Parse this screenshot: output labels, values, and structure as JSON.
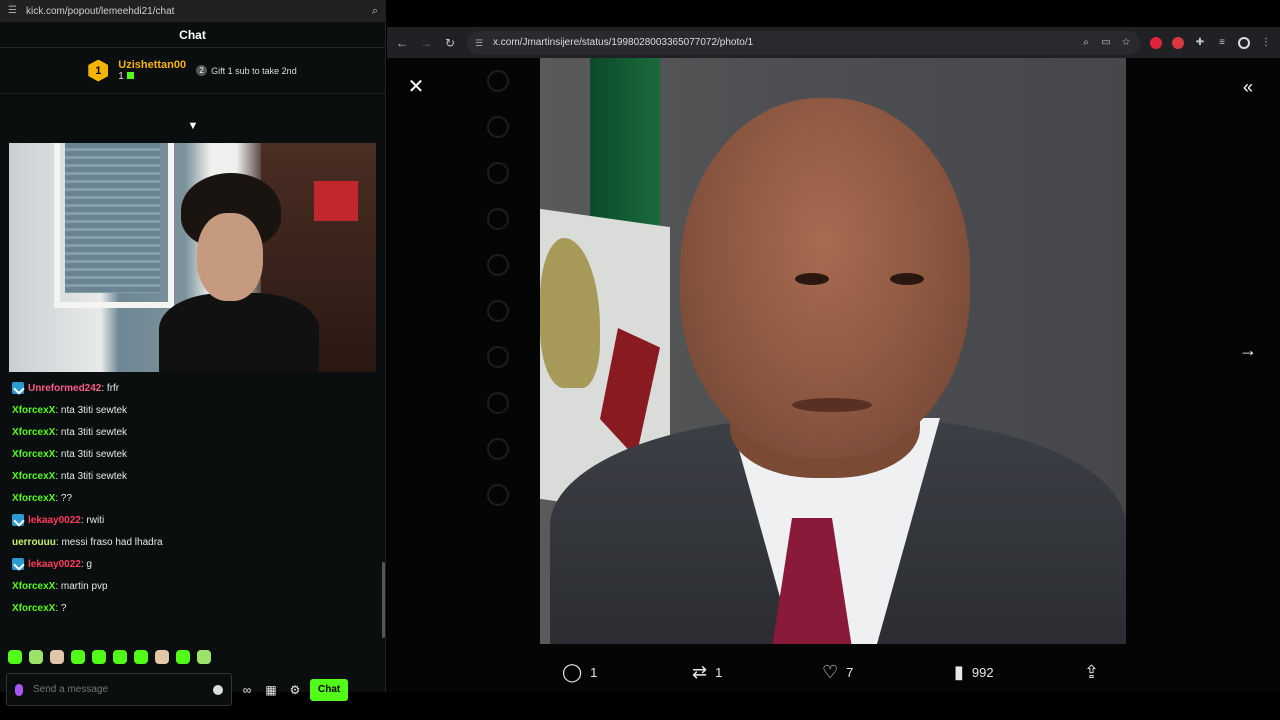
{
  "kick": {
    "url": "kick.com/popout/lemeehdi21/chat",
    "header_title": "Chat",
    "top_gifter": {
      "rank": "1",
      "name": "Uzishettan00",
      "count": "1"
    },
    "gift_cta": {
      "rank": "2",
      "label": "Gift 1 sub to take 2nd"
    },
    "messages": [
      {
        "user": "Unreformed242",
        "text": ": frfr",
        "color": "#ff5c8a",
        "badge": true
      },
      {
        "user": "XforcexX",
        "text": ": nta 3titi sewtek",
        "color": "#53fc18",
        "badge": false
      },
      {
        "user": "XforcexX",
        "text": ": nta 3titi sewtek",
        "color": "#53fc18",
        "badge": false
      },
      {
        "user": "XforcexX",
        "text": ": nta 3titi sewtek",
        "color": "#53fc18",
        "badge": false
      },
      {
        "user": "XforcexX",
        "text": ": nta 3titi sewtek",
        "color": "#53fc18",
        "badge": false
      },
      {
        "user": "XforcexX",
        "text": ": ??",
        "color": "#53fc18",
        "badge": false
      },
      {
        "user": "lekaay0022",
        "text": ": rwiti",
        "color": "#ff3b5c",
        "badge": true
      },
      {
        "user": "uerrouuu",
        "text": ": messi fraso had lhadra",
        "color": "#c6f26a",
        "badge": false
      },
      {
        "user": "lekaay0022",
        "text": ": g",
        "color": "#ff3b5c",
        "badge": true
      },
      {
        "user": "XforcexX",
        "text": ": martin pvp",
        "color": "#53fc18",
        "badge": false
      },
      {
        "user": "XforcexX",
        "text": ": ?",
        "color": "#53fc18",
        "badge": false
      }
    ],
    "input_placeholder": "Send a message",
    "send_label": "Chat",
    "accent": "#53fc18"
  },
  "browser": {
    "url": "x.com/Jmartinsijere/status/1998028003365077072/photo/1",
    "post_actions": {
      "replies": "1",
      "reposts": "1",
      "likes": "7",
      "views": "992"
    }
  }
}
